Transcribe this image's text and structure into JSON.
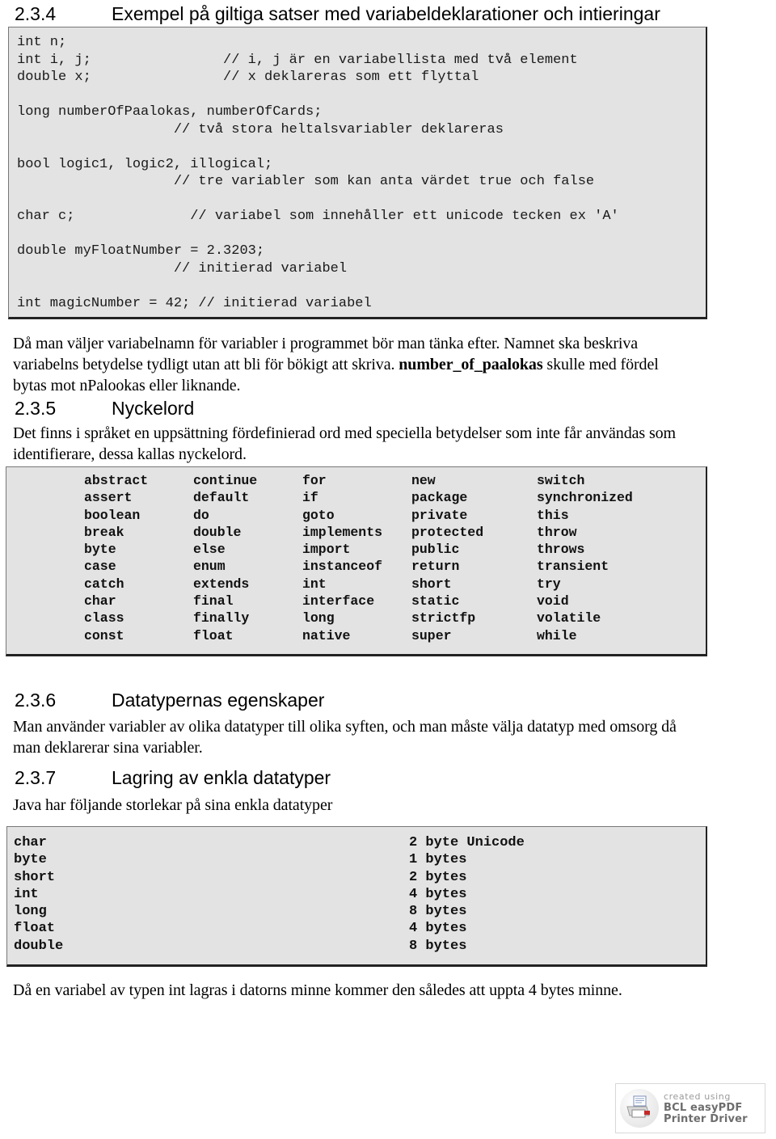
{
  "document": {
    "language": "sv",
    "sections": {
      "s234": {
        "number": "2.3.4",
        "title": "Exempel på giltiga satser med variabeldeklarationer och intieringar"
      },
      "s235": {
        "number": "2.3.5",
        "title": "Nyckelord"
      },
      "s236": {
        "number": "2.3.6",
        "title": "Datatypernas egenskaper"
      },
      "s237": {
        "number": "2.3.7",
        "title": "Lagring av enkla datatyper"
      }
    }
  },
  "code_example": {
    "lines": [
      "int n;",
      "int i, j;                // i, j är en variabellista med två element",
      "double x;                // x deklareras som ett flyttal",
      "",
      "long numberOfPaalokas, numberOfCards;",
      "                   // två stora heltalsvariabler deklareras",
      "",
      "bool logic1, logic2, illogical;",
      "                   // tre variabler som kan anta värdet true och false",
      "",
      "char c;              // variabel som innehåller ett unicode tecken ex 'A'",
      "",
      "double myFloatNumber = 2.3203;",
      "                   // initierad variabel",
      "",
      "int magicNumber = 42; // initierad variabel",
      ""
    ]
  },
  "paragraphs": {
    "naming_p1": "Då man väljer variabelnamn för variabler i programmet bör man tänka efter. Namnet ska beskriva variabelns betydelse tydligt utan att bli för bökigt att skriva. ",
    "naming_bold": "number_of_paalokas",
    "naming_p2": " skulle med fördel bytas mot nPalookas eller liknande.",
    "keywords_intro": "Det finns i språket en uppsättning fördefinierad ord med speciella betydelser som inte får användas som identifierare, dessa kallas nyckelord.",
    "datatypes_intro": "Man använder variabler av olika datatyper till olika syften, och man måste välja datatyp med omsorg då man deklarerar sina variabler.",
    "storage_intro": "Java har följande storlekar på sina enkla datatyper",
    "closing": "Då en variabel av typen int lagras i datorns minne kommer den således att uppta 4 bytes minne."
  },
  "keywords_table": {
    "rows": [
      [
        "abstract",
        "continue",
        "for",
        "new",
        "switch"
      ],
      [
        "assert",
        "default",
        "if",
        "package",
        "synchronized"
      ],
      [
        "boolean",
        "do",
        "goto",
        "private",
        "this"
      ],
      [
        "break",
        "double",
        "implements",
        "protected",
        "throw"
      ],
      [
        "byte",
        "else",
        "import",
        "public",
        "throws"
      ],
      [
        "case",
        "enum",
        "instanceof",
        "return",
        "transient"
      ],
      [
        "catch",
        "extends",
        "int",
        "short",
        "try"
      ],
      [
        "char",
        "final",
        "interface",
        "static",
        "void"
      ],
      [
        "class",
        "finally",
        "long",
        "strictfp",
        "volatile"
      ],
      [
        "const",
        "float",
        "native",
        "super",
        "while"
      ]
    ]
  },
  "datatype_sizes": {
    "rows": [
      {
        "type": "char",
        "size": "2 byte Unicode"
      },
      {
        "type": "byte",
        "size": "1 bytes"
      },
      {
        "type": "short",
        "size": "2 bytes"
      },
      {
        "type": "int",
        "size": "4 bytes"
      },
      {
        "type": "long",
        "size": "8 bytes"
      },
      {
        "type": "float",
        "size": "4 bytes"
      },
      {
        "type": "double",
        "size": "8 bytes"
      }
    ]
  },
  "footer_logo": {
    "line1": "created using",
    "line2": "BCL easyPDF",
    "line3": "Printer Driver"
  },
  "colors": {
    "code_background": "#e3e3e3",
    "code_border": "#222222",
    "page_background": "#ffffff",
    "text": "#000000"
  }
}
